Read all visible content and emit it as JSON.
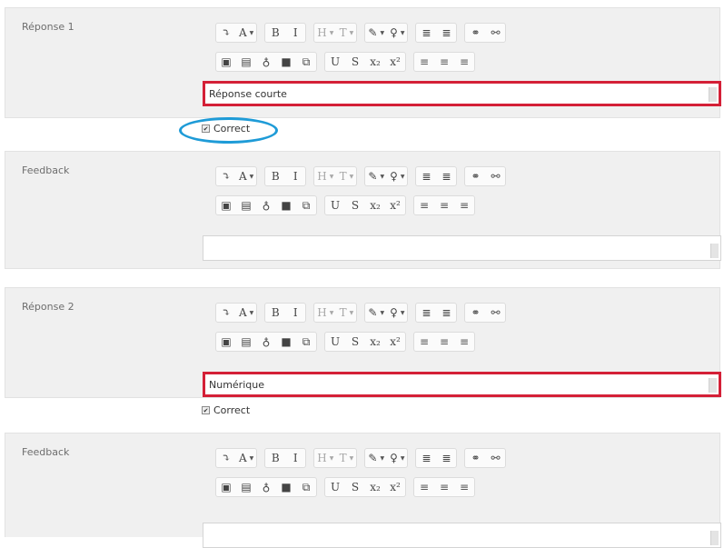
{
  "toolbar": {
    "row1": [
      {
        "name": "insert-icon",
        "glyph": "⤵",
        "caret": false,
        "dim": false,
        "group": 1
      },
      {
        "name": "font-size-icon",
        "glyph": "A",
        "caret": true,
        "dim": false,
        "group": 1
      },
      {
        "name": "bold-button",
        "glyph": "B",
        "caret": false,
        "dim": false,
        "group": 2
      },
      {
        "name": "italic-button",
        "glyph": "I",
        "caret": false,
        "dim": false,
        "group": 2
      },
      {
        "name": "heading-icon",
        "glyph": "H",
        "caret": true,
        "dim": true,
        "group": 3
      },
      {
        "name": "text-style-icon",
        "glyph": "T",
        "caret": true,
        "dim": true,
        "group": 3
      },
      {
        "name": "text-color-icon",
        "glyph": "✎",
        "caret": true,
        "dim": false,
        "group": 4
      },
      {
        "name": "background-color-icon",
        "glyph": "♀",
        "caret": true,
        "dim": false,
        "group": 4
      },
      {
        "name": "bullet-list-icon",
        "glyph": "≣",
        "caret": false,
        "dim": false,
        "group": 5
      },
      {
        "name": "numbered-list-icon",
        "glyph": "≣",
        "caret": false,
        "dim": false,
        "group": 5
      },
      {
        "name": "link-icon",
        "glyph": "⚭",
        "caret": false,
        "dim": false,
        "group": 6
      },
      {
        "name": "unlink-icon",
        "glyph": "⚯",
        "caret": false,
        "dim": false,
        "group": 6
      }
    ],
    "row2": [
      {
        "name": "image-icon",
        "glyph": "▣",
        "dim": false,
        "group": 1
      },
      {
        "name": "media-icon",
        "glyph": "▤",
        "dim": false,
        "group": 1
      },
      {
        "name": "microphone-icon",
        "glyph": "♁",
        "dim": false,
        "group": 1
      },
      {
        "name": "video-icon",
        "glyph": "■",
        "dim": false,
        "group": 1
      },
      {
        "name": "manage-files-icon",
        "glyph": "⧉",
        "dim": false,
        "group": 1
      },
      {
        "name": "underline-button",
        "glyph": "U",
        "dim": false,
        "group": 2
      },
      {
        "name": "strikethrough-button",
        "glyph": "S",
        "dim": false,
        "group": 2
      },
      {
        "name": "subscript-button",
        "glyph": "x₂",
        "dim": false,
        "group": 2
      },
      {
        "name": "superscript-button",
        "glyph": "x²",
        "dim": false,
        "group": 2
      },
      {
        "name": "align-left-icon",
        "glyph": "≡",
        "dim": false,
        "group": 3
      },
      {
        "name": "align-center-icon",
        "glyph": "≡",
        "dim": false,
        "group": 3
      },
      {
        "name": "align-right-icon",
        "glyph": "≡",
        "dim": false,
        "group": 3
      }
    ]
  },
  "sections": [
    {
      "id": "reponse1",
      "label": "Réponse 1",
      "content": "Réponse courte",
      "highlight": true
    },
    {
      "id": "feedback1",
      "label": "Feedback",
      "content": "",
      "highlight": false
    },
    {
      "id": "reponse2",
      "label": "Réponse 2",
      "content": "Numérique",
      "highlight": true
    },
    {
      "id": "feedback2",
      "label": "Feedback",
      "content": "",
      "highlight": false
    }
  ],
  "correct": [
    {
      "label": "Correct",
      "checked": true
    },
    {
      "label": "Correct",
      "checked": true
    }
  ],
  "colors": {
    "highlight_red": "#d42037",
    "highlight_blue": "#1e9bd7"
  }
}
